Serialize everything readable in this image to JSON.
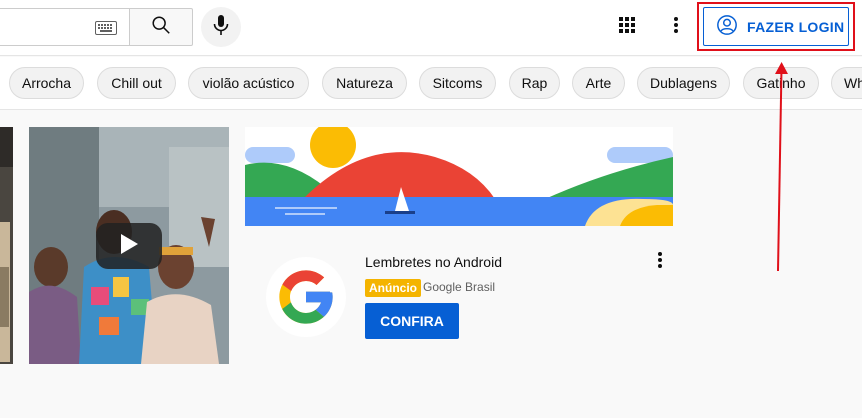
{
  "header": {
    "search_icon": "search-icon",
    "keyboard_icon": "keyboard-icon",
    "mic_icon": "mic-icon",
    "apps_icon": "apps-grid-icon",
    "more_icon": "more-vertical-icon",
    "login": {
      "label": "FAZER LOGIN",
      "icon": "account-circle-icon",
      "color": "#065fd4",
      "highlight_color": "#e0101a"
    }
  },
  "chips": [
    {
      "label": "Arrocha"
    },
    {
      "label": "Chill out"
    },
    {
      "label": "violão acústico"
    },
    {
      "label": "Natureza"
    },
    {
      "label": "Sitcoms"
    },
    {
      "label": "Rap"
    },
    {
      "label": "Arte"
    },
    {
      "label": "Dublagens"
    },
    {
      "label": "Gatinho"
    },
    {
      "label": "Wh"
    }
  ],
  "video": {
    "play_icon": "play-icon"
  },
  "ad": {
    "title": "Lembretes no Android",
    "badge": "Anúncio",
    "advertiser": "Google Brasil",
    "cta": "CONFIRA",
    "logo": "google-g-logo",
    "badge_color": "#f4b400",
    "cta_color": "#065fd4"
  }
}
